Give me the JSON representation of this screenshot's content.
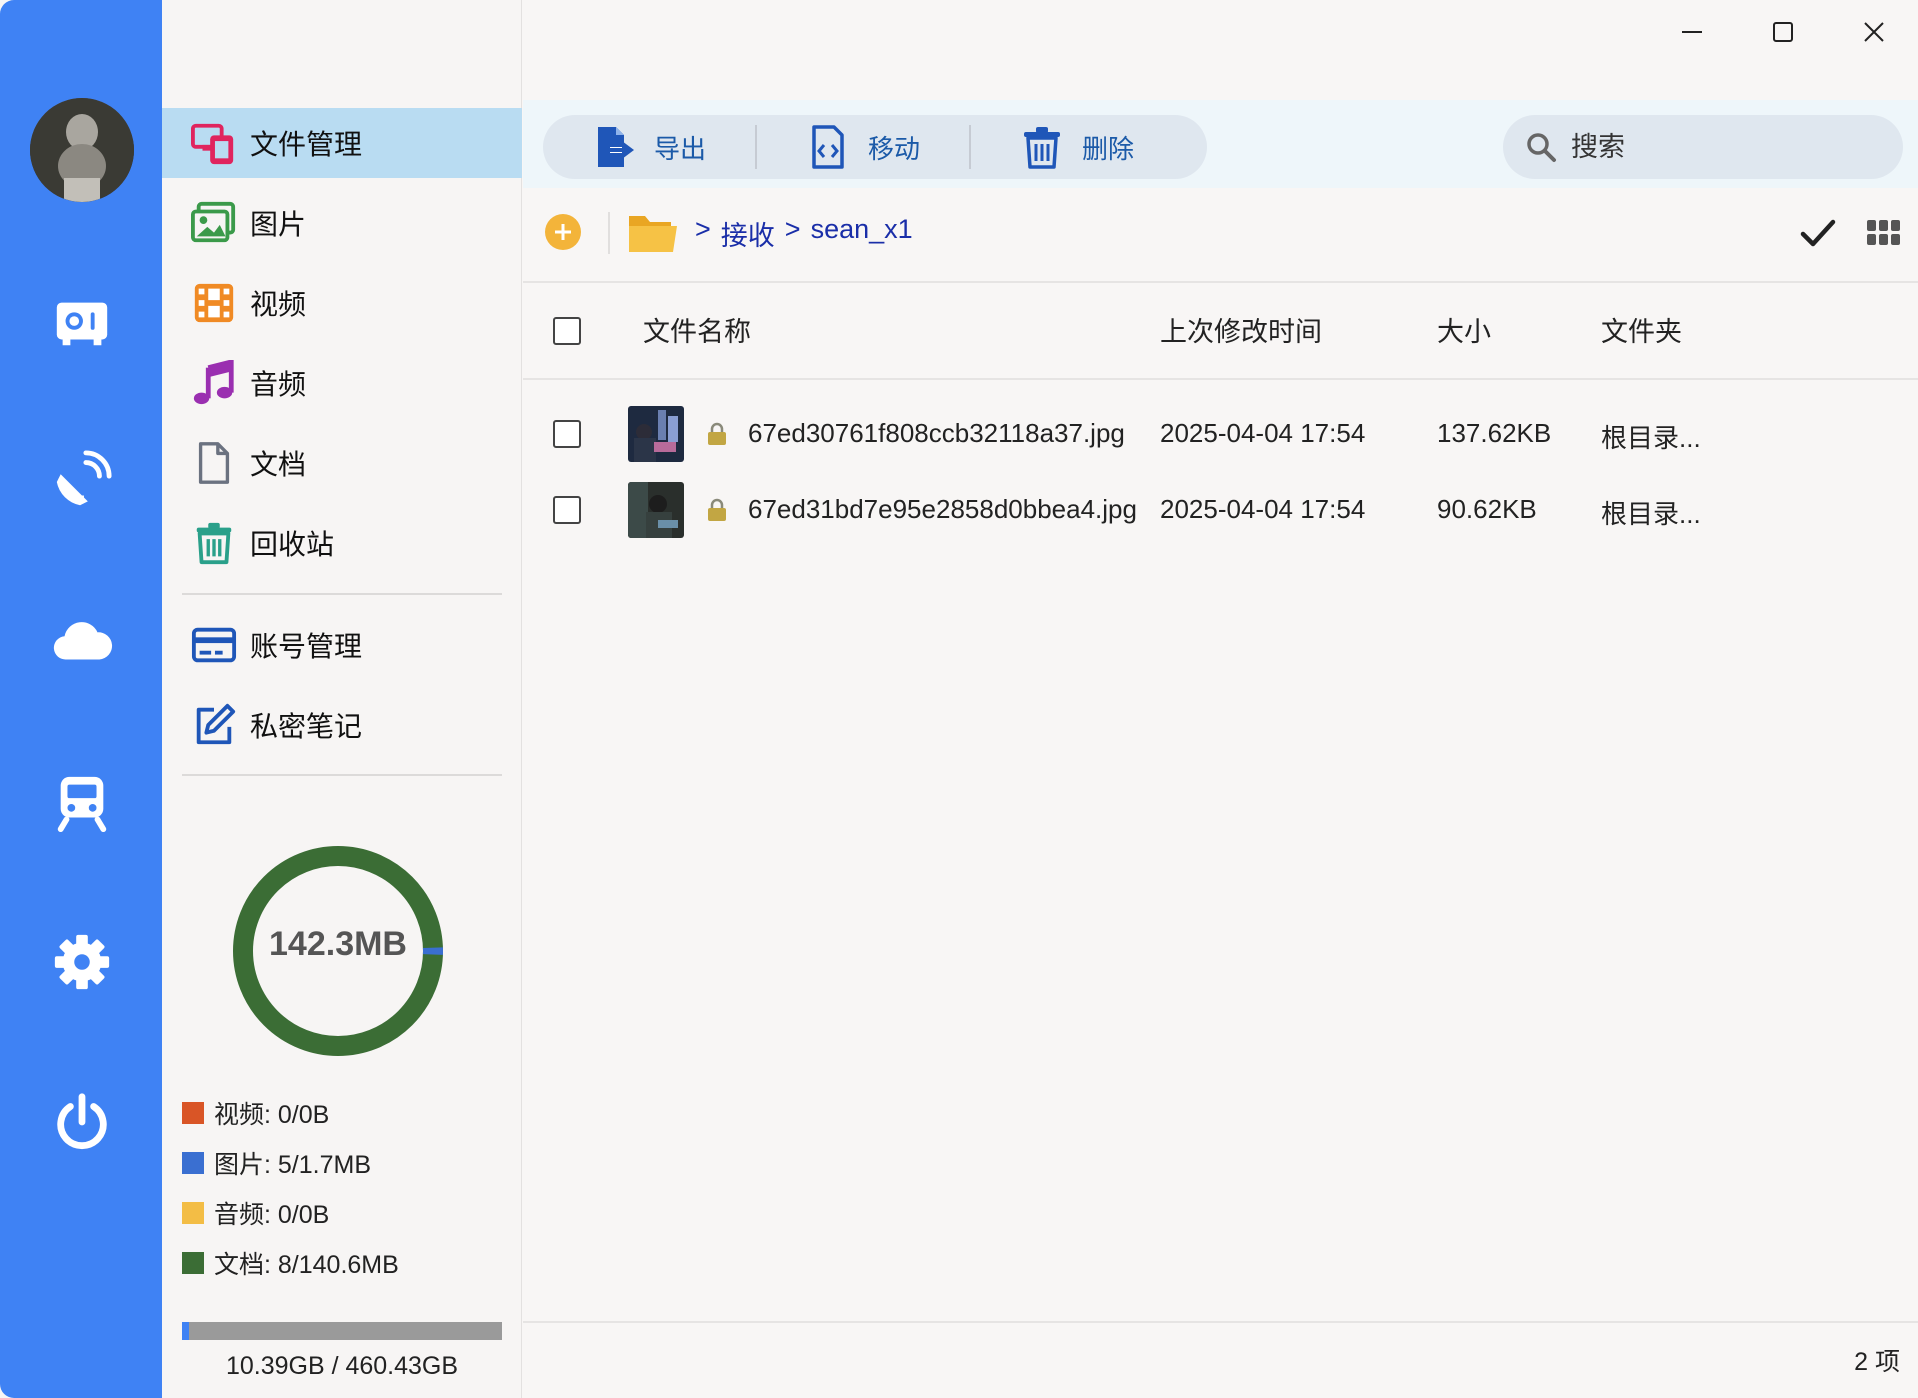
{
  "sidebar": {
    "items": [
      {
        "label": "文件管理",
        "icon": "devices-icon",
        "active": true
      },
      {
        "label": "图片",
        "icon": "image-icon"
      },
      {
        "label": "视频",
        "icon": "film-icon"
      },
      {
        "label": "音频",
        "icon": "music-icon"
      },
      {
        "label": "文档",
        "icon": "document-icon"
      },
      {
        "label": "回收站",
        "icon": "trash-icon"
      }
    ],
    "items2": [
      {
        "label": "账号管理",
        "icon": "id-card-icon"
      },
      {
        "label": "私密笔记",
        "icon": "edit-note-icon"
      }
    ],
    "usage": {
      "total_label": "142.3MB",
      "legend": [
        {
          "label": "视频: 0/0B",
          "color": "#d95526"
        },
        {
          "label": "图片: 5/1.7MB",
          "color": "#3a6fd1"
        },
        {
          "label": "音频: 0/0B",
          "color": "#f3bd45"
        },
        {
          "label": "文档: 8/140.6MB",
          "color": "#3b6d35"
        }
      ],
      "fractions": {
        "video": 0.0,
        "image": 0.012,
        "audio": 0.0,
        "document": 0.988
      },
      "storage_label": "10.39GB / 460.43GB",
      "storage_fraction": 0.0226
    }
  },
  "rail": {
    "icons": [
      "avatar",
      "radio-icon",
      "satellite-icon",
      "cloud-icon",
      "train-icon",
      "settings-icon",
      "power-icon"
    ],
    "color": "#3f82f4"
  },
  "toolbar": {
    "export_label": "导出",
    "move_label": "移动",
    "delete_label": "删除",
    "search_placeholder": "搜索"
  },
  "path": {
    "sep1": ">",
    "part1": "接收",
    "sep2": ">",
    "part2": "sean_x1"
  },
  "table": {
    "columns": {
      "name": "文件名称",
      "modified": "上次修改时间",
      "size": "大小",
      "folder": "文件夹"
    },
    "rows": [
      {
        "name": "67ed30761f808ccb32118a37.jpg",
        "modified": "2025-04-04 17:54",
        "size": "137.62KB",
        "folder": "根目录..."
      },
      {
        "name": "67ed31bd7e95e2858d0bbea4.jpg",
        "modified": "2025-04-04 17:54",
        "size": "90.62KB",
        "folder": "根目录..."
      }
    ]
  },
  "footer": {
    "count": "2 项"
  }
}
